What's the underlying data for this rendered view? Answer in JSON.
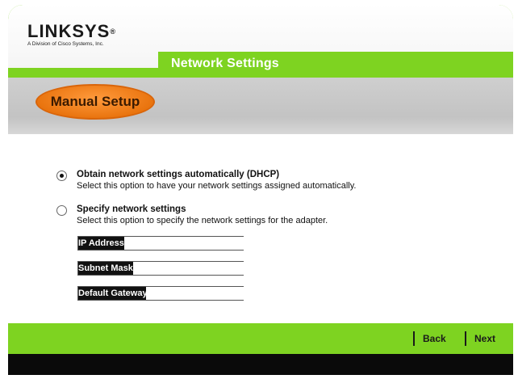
{
  "brand": {
    "logo_text": "LINKSYS",
    "logo_sub": "A Division of Cisco Systems, Inc."
  },
  "header": {
    "title": "Network Settings",
    "section": "Manual Setup"
  },
  "options": [
    {
      "title": "Obtain network settings automatically (DHCP)",
      "description": "Select this option to have your network settings assigned automatically.",
      "selected": true
    },
    {
      "title": "Specify network settings",
      "description": "Select this option to specify the network settings for the adapter.",
      "selected": false
    }
  ],
  "fields": {
    "ip_address": {
      "label": "IP Address",
      "value": ""
    },
    "subnet_mask": {
      "label": "Subnet Mask",
      "value": ""
    },
    "default_gateway": {
      "label": "Default Gateway",
      "value": ""
    }
  },
  "nav": {
    "back_label": "Back",
    "next_label": "Next"
  },
  "colors": {
    "accent_green": "#7ed321",
    "accent_orange": "#e8720c"
  }
}
